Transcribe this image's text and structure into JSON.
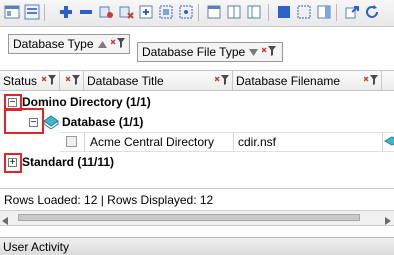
{
  "grouping": {
    "chips": [
      "Database Type",
      "Database File Type"
    ]
  },
  "columns": [
    {
      "label": "Status"
    },
    {
      "label": ""
    },
    {
      "label": "Database Title"
    },
    {
      "label": "Database Filename"
    },
    {
      "label": ""
    }
  ],
  "groups": {
    "domino": "Domino Directory (1/1)",
    "database": "Database (1/1)",
    "standard": "Standard (11/11)"
  },
  "row": {
    "title": "Acme Central Directory",
    "filename": "cdir.nsf"
  },
  "status": {
    "text": "Rows Loaded: 12  |  Rows Displayed: 12"
  },
  "panel": {
    "title": "User Activity"
  },
  "colors": {
    "highlight": "#e0262a",
    "accent": "#2d61c7"
  },
  "icons": [
    "open-database-icon",
    "view-icon",
    "add-icon",
    "remove-icon",
    "connect-icon",
    "disconnect-icon",
    "expand-columns-icon",
    "select-icon",
    "pane-icon",
    "split-view-icon",
    "layout-icon",
    "blue-square-icon",
    "layout-grid-icon",
    "export-icon",
    "refresh-icon",
    "filter-icon",
    "database-icon"
  ]
}
